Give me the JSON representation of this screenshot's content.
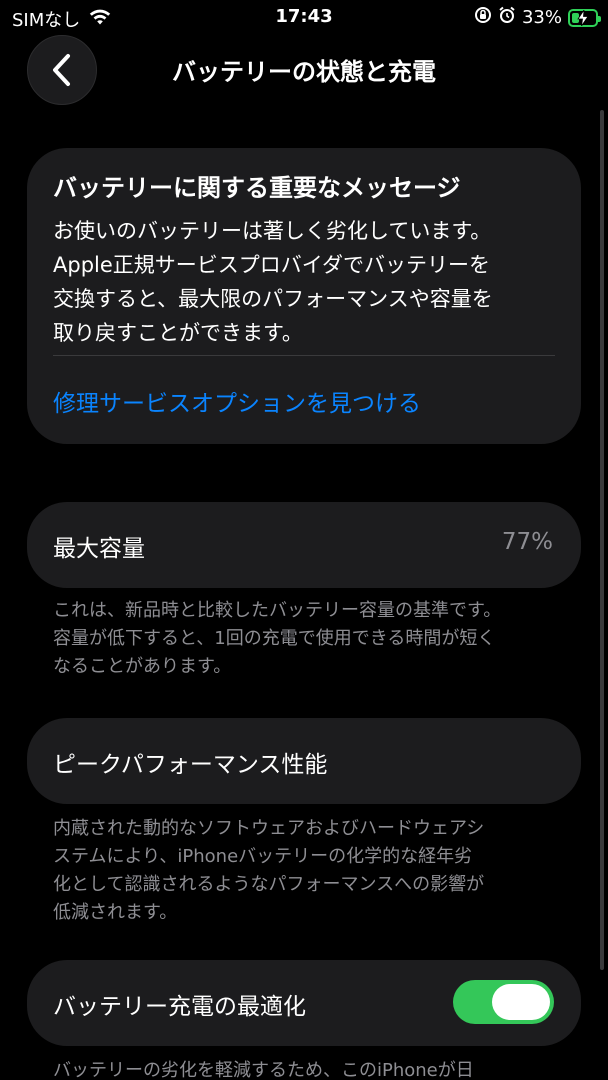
{
  "status_bar": {
    "carrier": "SIMなし",
    "time": "17:43",
    "battery_percent": "33%",
    "battery_level": 0.33,
    "icons": [
      "wifi-icon",
      "orientation-lock-icon",
      "alarm-icon",
      "battery-charging-icon"
    ]
  },
  "header": {
    "title": "バッテリーの状態と充電",
    "back_icon": "chevron-left-icon"
  },
  "message_card": {
    "title": "バッテリーに関する重要なメッセージ",
    "body": "お使いのバッテリーは著しく劣化しています。\nApple正規サービスプロバイダでバッテリーを\n交換すると、最大限のパフォーマンスや容量を\n取り戻すことができます。",
    "link": "修理サービスオプションを見つける"
  },
  "max_capacity": {
    "label": "最大容量",
    "value": "77%",
    "footnote": "これは、新品時と比較したバッテリー容量の基準です。\n容量が低下すると、1回の充電で使用できる時間が短く\nなることがあります。"
  },
  "peak_performance": {
    "label": "ピークパフォーマンス性能",
    "footnote": "内蔵された動的なソフトウェアおよびハードウェアシ\nステムにより、iPhoneバッテリーの化学的な経年劣\n化として認識されるようなパフォーマンスへの影響が\n低減されます。"
  },
  "charge_optimization": {
    "label": "バッテリー充電の最適化",
    "enabled": true,
    "footnote": "バッテリーの劣化を軽減するため、このiPhoneが日"
  },
  "colors": {
    "background": "#000000",
    "card": "#1c1c1e",
    "link": "#0a84ff",
    "toggle_on": "#34c759",
    "secondary_text": "#8e8e93",
    "battery": "#2fd158"
  }
}
